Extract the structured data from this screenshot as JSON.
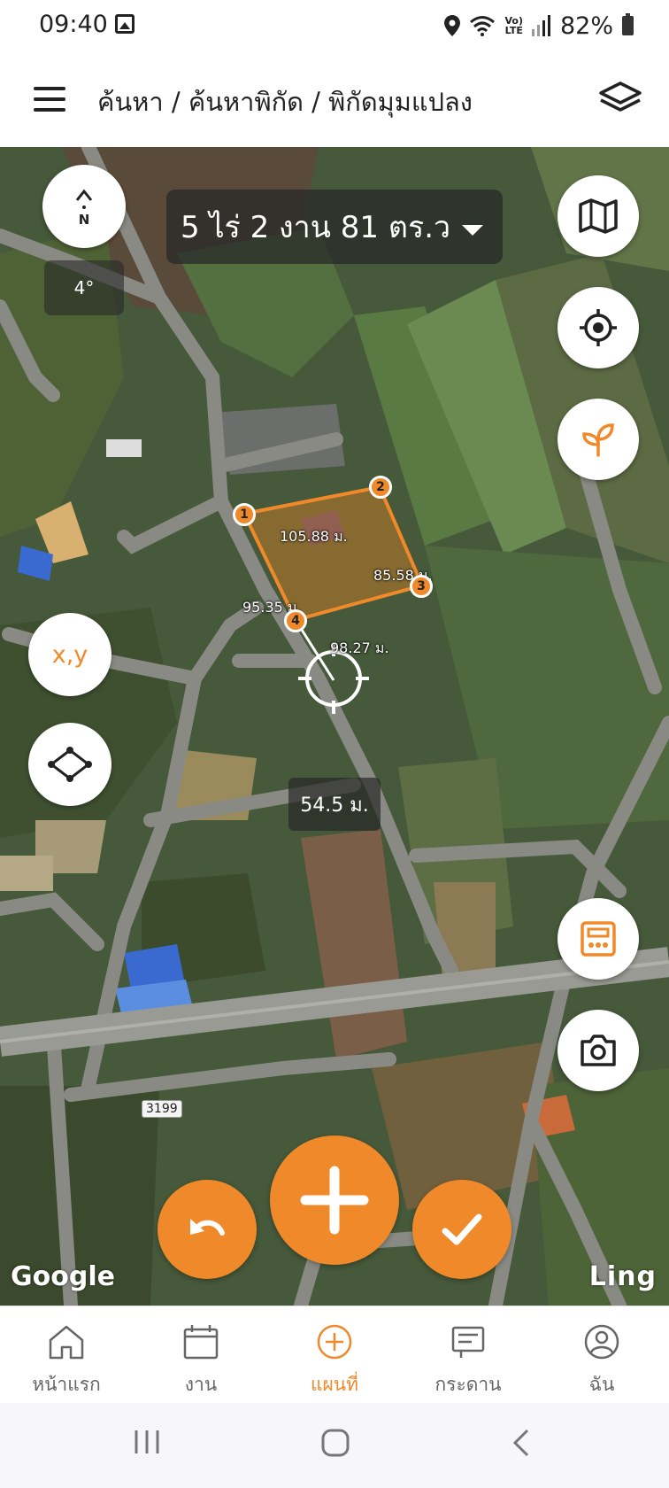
{
  "status": {
    "time": "09:40",
    "battery": "82%",
    "network": "LTE",
    "volte": "Vo)"
  },
  "header": {
    "breadcrumb": "ค้นหา / ค้นหาพิกัด / พิกัดมุมแปลง",
    "menu_icon": "menu-icon",
    "layers_icon": "layers-icon"
  },
  "map": {
    "area": "5 ไร่ 2 งาน 81 ตร.ว",
    "compass_label": "N",
    "compass_angle": "4°",
    "xy_label": "x,y",
    "measure_distance": "54.5 ม.",
    "segments": [
      "105.88 ม.",
      "85.58 ม.",
      "98.27 ม.",
      "95.35 ม."
    ],
    "vertices": [
      "1",
      "2",
      "3",
      "4"
    ],
    "road_number": "3199",
    "google_attr": "Google",
    "ling_attr": "Ling",
    "accent_color": "#f0892a"
  },
  "tabs": [
    {
      "label": "หน้าแรก",
      "icon": "home-icon"
    },
    {
      "label": "งาน",
      "icon": "calendar-icon"
    },
    {
      "label": "แผนที่",
      "icon": "add-circle-icon",
      "active": true
    },
    {
      "label": "กระดาน",
      "icon": "board-icon"
    },
    {
      "label": "ฉัน",
      "icon": "profile-icon"
    }
  ]
}
